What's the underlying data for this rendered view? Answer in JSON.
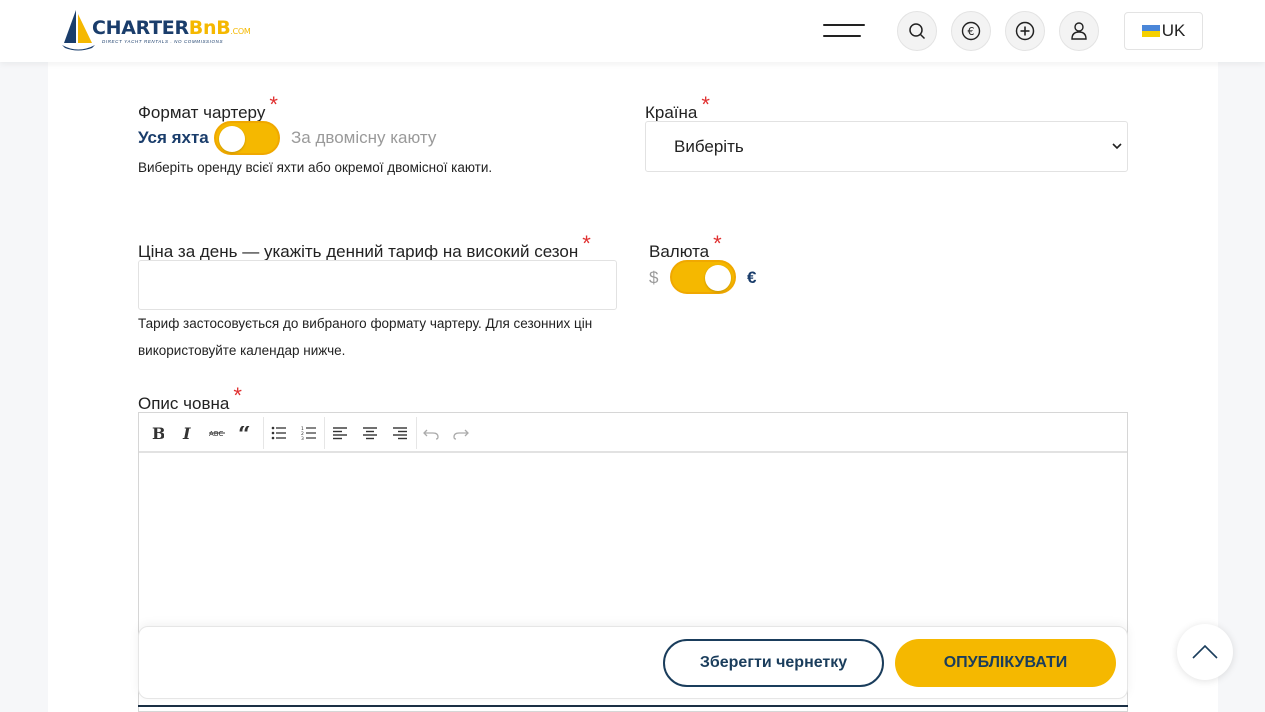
{
  "header": {
    "logo": {
      "brand": "CHARTER",
      "brand_accent": "BnB",
      "domain": ".COM",
      "tagline": "DIRECT YACHT RENTALS . NO COMMISSIONS"
    },
    "icons": [
      "menu-icon",
      "search-icon",
      "euro-icon",
      "add-icon",
      "user-icon"
    ],
    "language": "UK"
  },
  "form": {
    "charter_format": {
      "label": "Формат чартеру",
      "required_mark": "*",
      "option_left": "Уся яхта",
      "option_right": "За двомісну каюту",
      "selected": "Уся яхта",
      "help": "Виберіть оренду всієї яхти або окремої двомісної каюти."
    },
    "country": {
      "label": "Країна",
      "required_mark": "*",
      "value": "Виберіть"
    },
    "price": {
      "label": "Ціна за день — укажіть денний тариф на високий сезон",
      "required_mark": "*",
      "value": "",
      "help_line1": "Тариф застосовується до вибраного формату чартеру. Для сезонних цін",
      "help_line2": "використовуйте календар нижче."
    },
    "currency": {
      "label": "Валюта",
      "required_mark": "*",
      "option_left": "$",
      "option_right": "€",
      "selected": "€"
    },
    "description": {
      "label": "Опис човна",
      "required_mark": "*",
      "toolbar": [
        "bold-icon",
        "italic-icon",
        "strikethrough-icon",
        "quote-icon",
        "bullet-list-icon",
        "numbered-list-icon",
        "align-left-icon",
        "align-center-icon",
        "align-right-icon",
        "undo-icon",
        "redo-icon"
      ],
      "value": ""
    }
  },
  "actions": {
    "save_draft": "Зберегти чернетку",
    "publish": "ОПУБЛІКУВАТИ"
  },
  "colors": {
    "accent": "#f5b800",
    "navy": "#1a3d5c",
    "required": "#e03030"
  }
}
